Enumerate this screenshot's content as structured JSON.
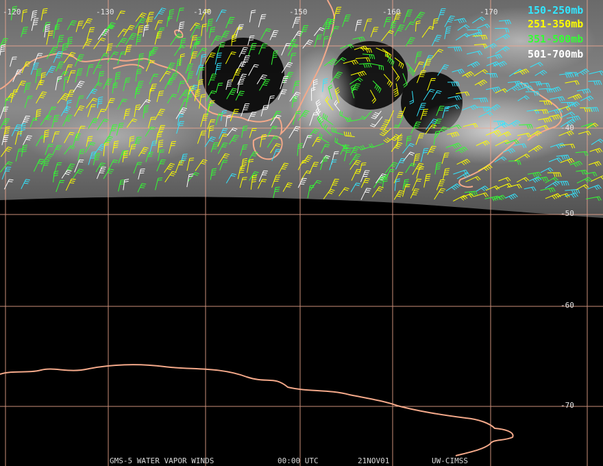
{
  "legend": [
    {
      "label": "150-250mb",
      "color": "#33e6ff"
    },
    {
      "label": "251-350mb",
      "color": "#ffff00"
    },
    {
      "label": "351-500mb",
      "color": "#33ff33"
    },
    {
      "label": "501-700mb",
      "color": "#ffffff"
    }
  ],
  "longitude_labels": [
    "-120",
    "-130",
    "-140",
    "-150",
    "-160",
    "-170"
  ],
  "latitude_labels": [
    "-40",
    "-50",
    "-60",
    "-70"
  ],
  "footer": {
    "satellite": "GMS-5 WATER VAPOR WINDS",
    "time": "00:00 UTC",
    "date": "21NOV01",
    "source": "UW-CIMSS"
  },
  "colors": {
    "grid": "#f0a890",
    "coast": "#f4a98a",
    "background": "#000000",
    "cloud": "#9a9a9a"
  }
}
